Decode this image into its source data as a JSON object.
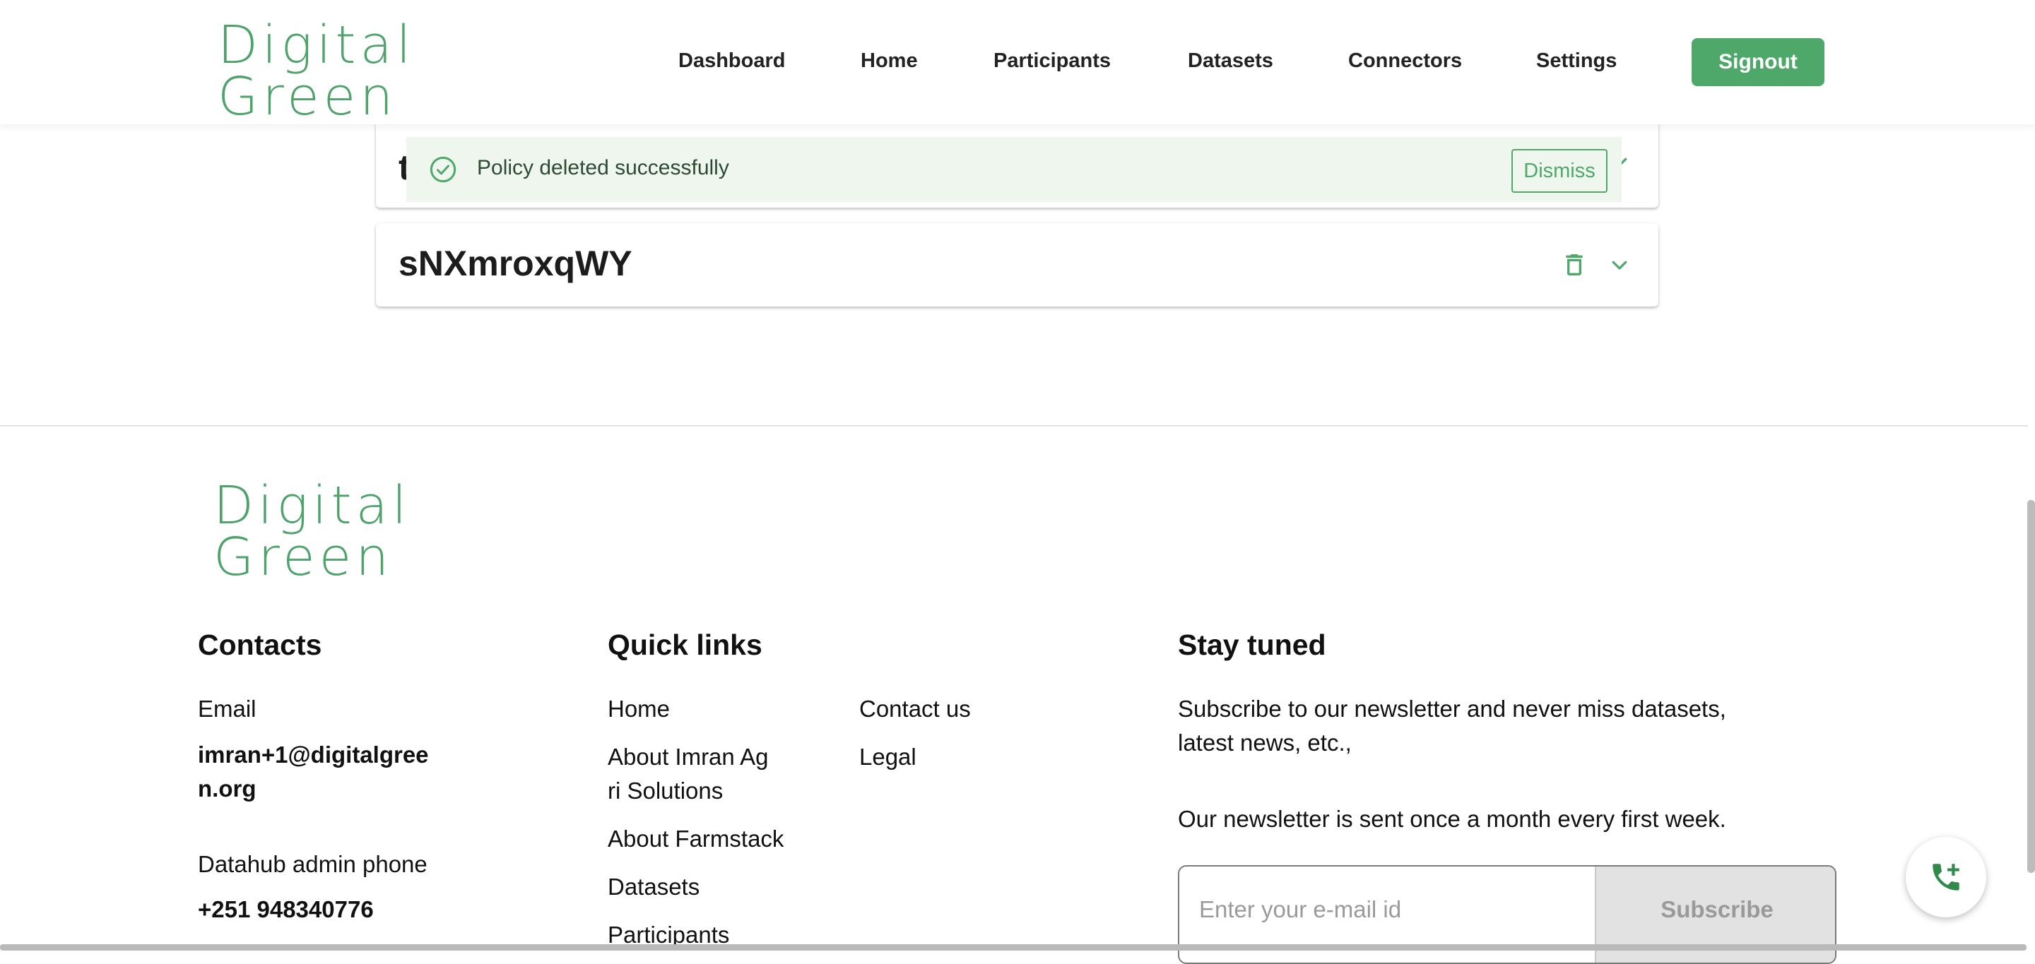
{
  "header": {
    "logo_line1": "Digital",
    "logo_line2": "Green",
    "nav": [
      "Dashboard",
      "Home",
      "Participants",
      "Datasets",
      "Connectors",
      "Settings"
    ],
    "signout_label": "Signout"
  },
  "toast": {
    "message": "Policy deleted successfully",
    "dismiss_label": "Dismiss",
    "icon": "check-circle-icon"
  },
  "policies": [
    {
      "title": "t",
      "expanded": false
    },
    {
      "title": "sNXmroxqWY",
      "expanded": false
    }
  ],
  "footer": {
    "logo_line1": "Digital",
    "logo_line2": "Green",
    "contacts": {
      "heading": "Contacts",
      "email_label": "Email",
      "email_value_1": "imran+1@digitalgree",
      "email_value_2": "n.org",
      "phone_label": "Datahub admin phone",
      "phone_value": "+251 948340776"
    },
    "quick_links": {
      "heading": "Quick links",
      "home": "Home",
      "about_org_1": "About Imran Ag",
      "about_org_2": "ri Solutions",
      "about_farmstack": "About Farmstack",
      "datasets": "Datasets",
      "participants": "Participants",
      "contact_us": "Contact us",
      "legal": "Legal"
    },
    "stay_tuned": {
      "heading": "Stay tuned",
      "desc_1": "Subscribe to our newsletter and never miss datasets,",
      "desc_2": "latest news, etc.,",
      "note": "Our newsletter is sent once a month every first week.",
      "email_placeholder": "Enter your e-mail id",
      "subscribe_label": "Subscribe"
    }
  },
  "colors": {
    "brand_green": "#4ea86a",
    "toast_bg": "#eff6ee"
  }
}
